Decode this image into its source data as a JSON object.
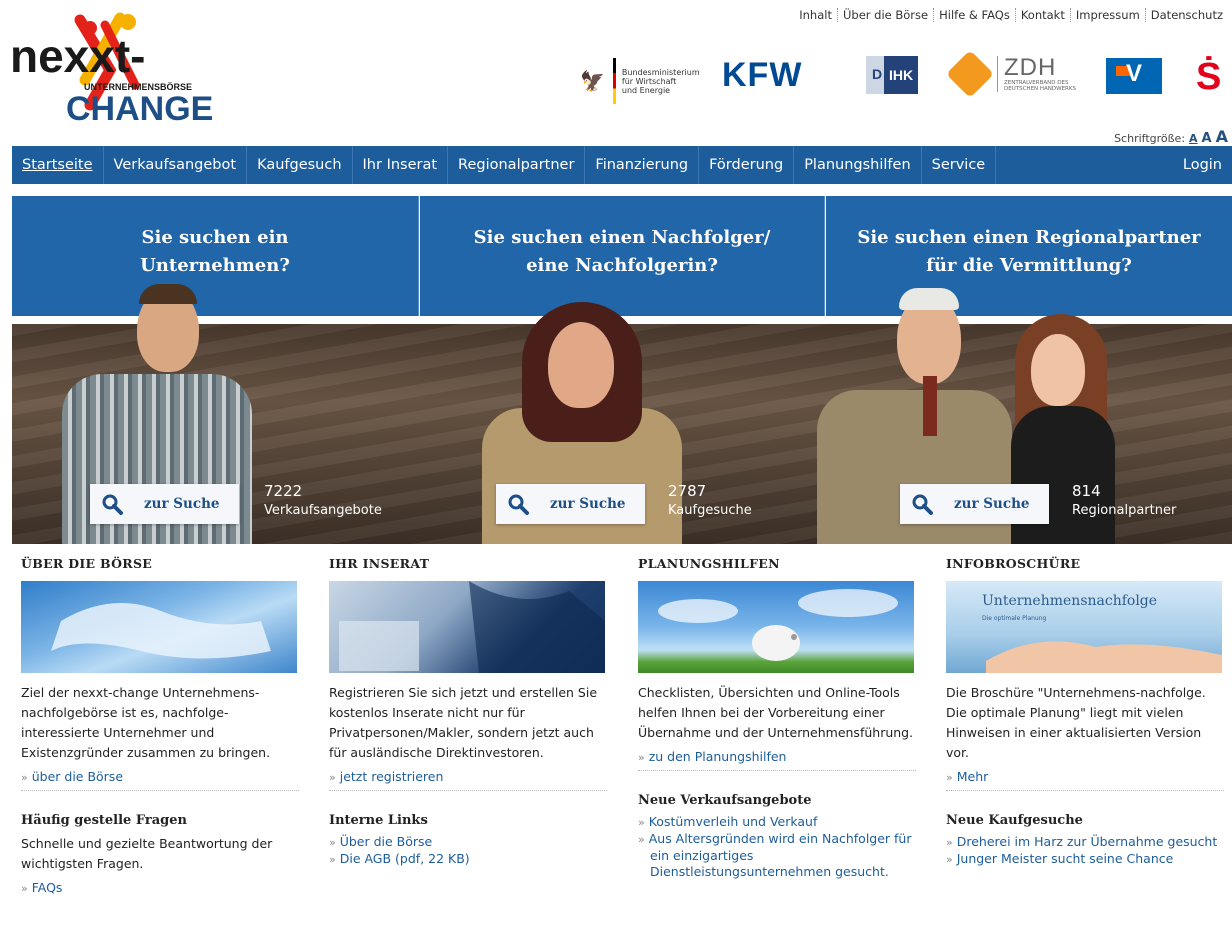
{
  "top_links": [
    "Inhalt",
    "Über die Börse",
    "Hilfe & FAQs",
    "Kontakt",
    "Impressum",
    "Datenschutz"
  ],
  "logo": {
    "line1": "nexxt-",
    "line2": "UNTERNEHMENSBÖRSE",
    "line3": "CHANGE"
  },
  "partners": {
    "bmwi": [
      "Bundesministerium",
      "für Wirtschaft",
      "und Energie"
    ],
    "kfw": "KFW",
    "dihk": "IHK",
    "dihk_d": "D",
    "zdh": "ZDH",
    "zdh_sub": [
      "ZENTRALVERBAND DES",
      "DEUTSCHEN HANDWERKS"
    ],
    "sparkasse": "Ṡ"
  },
  "fontsize": {
    "label": "Schriftgröße:",
    "a": "A"
  },
  "nav": {
    "items": [
      "Startseite",
      "Verkaufsangebot",
      "Kaufgesuch",
      "Ihr Inserat",
      "Regionalpartner",
      "Finanzierung",
      "Förderung",
      "Planungshilfen",
      "Service"
    ],
    "login": "Login"
  },
  "hero": {
    "panels": [
      [
        "Sie suchen ein",
        "Unternehmen?"
      ],
      [
        "Sie suchen einen Nachfolger/",
        "eine Nachfolgerin?"
      ],
      [
        "Sie suchen einen Regionalpartner",
        "für die Vermittlung?"
      ]
    ],
    "search_label": "zur Suche",
    "counts": [
      {
        "n": "7222",
        "label": "Verkaufsangebote"
      },
      {
        "n": "2787",
        "label": "Kaufgesuche"
      },
      {
        "n": "814",
        "label": "Regionalpartner"
      }
    ]
  },
  "columns": [
    {
      "title": "ÜBER DIE BÖRSE",
      "text": "Ziel der nexxt-change Unternehmens-nachfolgebörse ist es, nachfolge-interessierte Unternehmer und Existenzgründer zusammen zu bringen.",
      "more": "über die Börse",
      "sub_title": "Häufig gestelle Fragen",
      "sub_text": "Schnelle und gezielte Beantwortung der wichtigsten Fragen.",
      "links": [
        "FAQs"
      ]
    },
    {
      "title": "IHR INSERAT",
      "text": "Registrieren Sie sich jetzt und erstellen Sie kostenlos Inserate nicht nur für Privatpersonen/Makler, sondern jetzt auch für ausländische Direktinvestoren.",
      "more": "jetzt registrieren",
      "sub_title": "Interne Links",
      "sub_text": "",
      "links": [
        "Über die Börse",
        "Die AGB (pdf, 22 KB)"
      ]
    },
    {
      "title": "PLANUNGSHILFEN",
      "text": "Checklisten, Übersichten und Online-Tools helfen Ihnen bei der Vorbereitung einer Übernahme und der Unternehmensführung.",
      "more": "zu den Planungshilfen",
      "sub_title": "Neue Verkaufsangebote",
      "sub_text": "",
      "links": [
        "Kostümverleih und Verkauf",
        "Aus Altersgründen wird ein Nachfolger für ein einzigartiges Dienstleistungsunternehmen gesucht."
      ]
    },
    {
      "title": "INFOBROSCHÜRE",
      "image_text": "Unternehmensnachfolge",
      "image_subtext": "Die optimale Planung",
      "text": "Die Broschüre \"Unternehmens-nachfolge. Die optimale Planung\" liegt mit vielen Hinweisen in einer aktualisierten Version vor.",
      "more": "Mehr",
      "sub_title": "Neue Kaufgesuche",
      "sub_text": "",
      "links": [
        "Dreherei im Harz zur Übernahme gesucht",
        "Junger Meister sucht seine Chance"
      ]
    }
  ],
  "link_prefix": "»",
  "colors": {
    "nav": "#1d5d9b",
    "panel": "#2166a8",
    "link": "#1d5d9b"
  }
}
